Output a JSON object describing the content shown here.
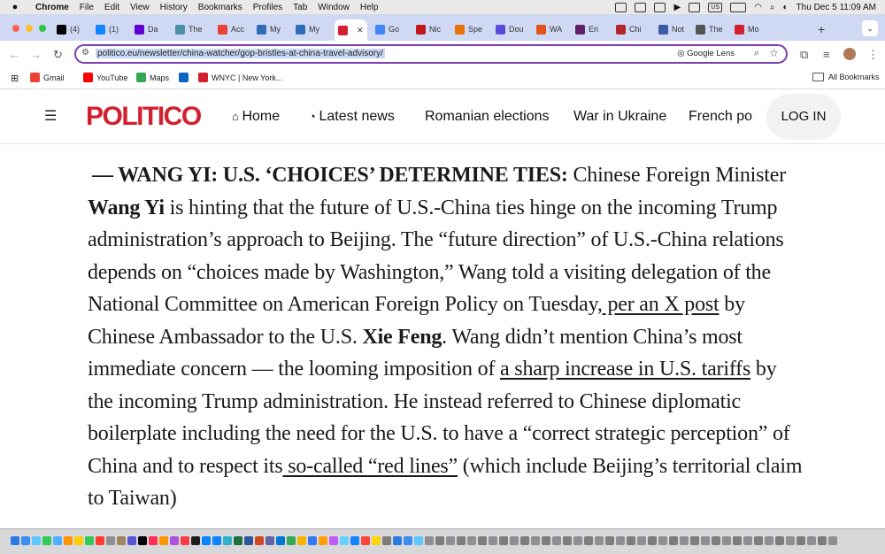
{
  "menubar": {
    "items": [
      "Chrome",
      "File",
      "Edit",
      "View",
      "History",
      "Bookmarks",
      "Profiles",
      "Tab",
      "Window",
      "Help"
    ],
    "status": {
      "us": "US",
      "clock": "Thu Dec 5  11:09 AM"
    }
  },
  "tabs": [
    {
      "label": "(4)",
      "icon": "x-logo-icon",
      "color": "#000000"
    },
    {
      "label": "(1)",
      "icon": "bluesky-icon",
      "color": "#1185fe"
    },
    {
      "label": "Da",
      "icon": "yahoo-icon",
      "color": "#6001d2"
    },
    {
      "label": "The",
      "icon": "page-icon",
      "color": "#4a90a4"
    },
    {
      "label": "Acc",
      "icon": "gmail-icon",
      "color": "#ea4335"
    },
    {
      "label": "My",
      "icon": "de-icon",
      "color": "#2f6db5"
    },
    {
      "label": "My",
      "icon": "de-icon",
      "color": "#2f6db5"
    },
    {
      "label": "",
      "icon": "politico-icon",
      "color": "#d3202f",
      "active": true
    },
    {
      "label": "Go",
      "icon": "google-icon",
      "color": "#4285f4"
    },
    {
      "label": "Nic",
      "icon": "nic-icon",
      "color": "#c4151c"
    },
    {
      "label": "Spe",
      "icon": "spe-icon",
      "color": "#e8710a"
    },
    {
      "label": "Dou",
      "icon": "t-icon",
      "color": "#5b4bdb"
    },
    {
      "label": "WA",
      "icon": "wa-icon",
      "color": "#e2541b"
    },
    {
      "label": "Eri",
      "icon": "slack-icon",
      "color": "#611f69"
    },
    {
      "label": "Chi",
      "icon": "chi-icon",
      "color": "#b3262e"
    },
    {
      "label": "Not",
      "icon": "not-icon",
      "color": "#3b5ba5"
    },
    {
      "label": "The",
      "icon": "w-icon",
      "color": "#555555"
    },
    {
      "label": "Mo",
      "icon": "politico-icon",
      "color": "#d3202f"
    }
  ],
  "toolbar": {
    "url": "politico.eu/newsletter/china-watcher/gop-bristles-at-china-travel-advisory/",
    "lens_label": "Google Lens"
  },
  "bookmarks": {
    "items": [
      {
        "label": "Gmail",
        "icon": "gmail-icon",
        "color": "#ea4335"
      },
      {
        "label": "YouTube",
        "icon": "youtube-icon",
        "color": "#ff0000"
      },
      {
        "label": "Maps",
        "icon": "maps-icon",
        "color": "#34a853"
      },
      {
        "label": "",
        "icon": "linkedin-icon",
        "color": "#0a66c2"
      },
      {
        "label": "WNYC | New York...",
        "icon": "wnyc-icon",
        "color": "#d3202f"
      }
    ],
    "all_label": "All Bookmarks"
  },
  "header": {
    "logo": "POLITICO",
    "nav": [
      "Home",
      "Latest news",
      "Romanian elections",
      "War in Ukraine",
      "French po"
    ],
    "login": "LOG IN"
  },
  "article": {
    "p": [
      "— WANG YI: U.S. ‘CHOICES’ DETERMINE TIES:",
      " Chinese Foreign Minister ",
      "Wang Yi",
      " is hinting that the future of U.S.-China ties hinge on the incoming Trump administration’s approach to Beijing. The “future direction” of U.S.-China relations depends on “choices made by Washington,” Wang told a visiting delegation of the National Committee on American Foreign Policy on Tuesday,",
      " per an X post",
      " by Chinese Ambassador to the U.S. ",
      "Xie Feng",
      ". Wang didn’t mention China’s most immediate concern — the looming imposition of ",
      "a sharp increase in U.S. tariffs",
      " by the incoming Trump administration. He instead referred to Chinese diplomatic boilerplate including the need for the U.S. to have a “correct strategic perception” of China and to respect its",
      " so-called “red lines”",
      " (which include Beijing’s territorial claim to Taiwan)"
    ]
  },
  "dock": {
    "colors": [
      "#2a7ae2",
      "#3b8ef0",
      "#5ac8fa",
      "#34c759",
      "#4fb0ff",
      "#ff9500",
      "#ffcc00",
      "#34c759",
      "#ff3b30",
      "#8e8e93",
      "#a2845e",
      "#5856d6",
      "#000000",
      "#ff2d55",
      "#ff9500",
      "#af52de",
      "#fc3c44",
      "#1f1f1f",
      "#0a84ff",
      "#0a84ff",
      "#30b0c7",
      "#1d6f42",
      "#2b579a",
      "#d24726",
      "#6264a7",
      "#0078d4",
      "#34a853",
      "#f4b400",
      "#3478f6",
      "#ff9f0a",
      "#bf5af2",
      "#64d2ff",
      "#1185fe",
      "#ff453a",
      "#ffd60a",
      "#7d7d7d",
      "#2a7ae2",
      "#3b8ef0",
      "#5ac8fa",
      "#8e8e93",
      "#7d7d7d",
      "#8e8e93",
      "#7d7d7d",
      "#8e8e93",
      "#7d7d7d",
      "#8e8e93",
      "#7d7d7d",
      "#8e8e93",
      "#7d7d7d",
      "#8e8e93",
      "#7d7d7d",
      "#8e8e93",
      "#7d7d7d",
      "#8e8e93",
      "#7d7d7d",
      "#8e8e93",
      "#7d7d7d",
      "#8e8e93",
      "#7d7d7d",
      "#8e8e93",
      "#7d7d7d",
      "#8e8e93",
      "#7d7d7d",
      "#8e8e93",
      "#7d7d7d",
      "#8e8e93",
      "#7d7d7d",
      "#8e8e93",
      "#7d7d7d",
      "#8e8e93",
      "#7d7d7d",
      "#8e8e93",
      "#7d7d7d",
      "#8e8e93",
      "#7d7d7d",
      "#8e8e93",
      "#7d7d7d",
      "#8e8e93"
    ]
  }
}
